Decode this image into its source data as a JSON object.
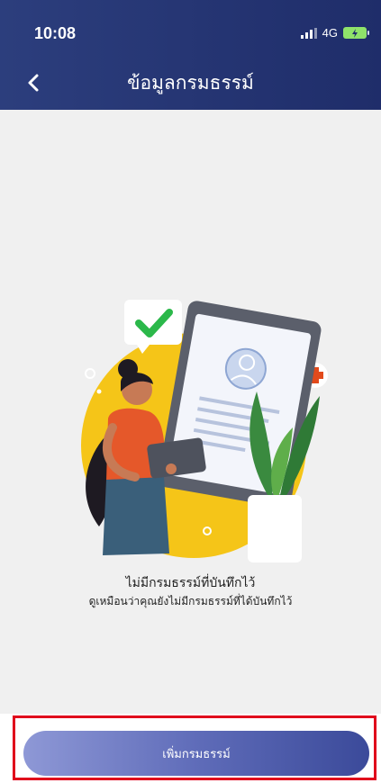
{
  "status_bar": {
    "time": "10:08",
    "network": "4G"
  },
  "header": {
    "title": "ข้อมูลกรมธรรม์"
  },
  "empty_state": {
    "title": "ไม่มีกรมธรรม์ที่บันทึกไว้",
    "subtitle": "ดูเหมือนว่าคุณยังไม่มีกรมธรรม์ที่ได้บันทึกไว้"
  },
  "actions": {
    "add_label": "เพิ่มกรมธรรม์"
  },
  "colors": {
    "header_bg": "#26357a",
    "illustration_yellow": "#f5c518",
    "check_green": "#2bb84a",
    "button_start": "#8e98d6",
    "button_end": "#3b4a9a",
    "highlight_red": "#e0001b"
  }
}
